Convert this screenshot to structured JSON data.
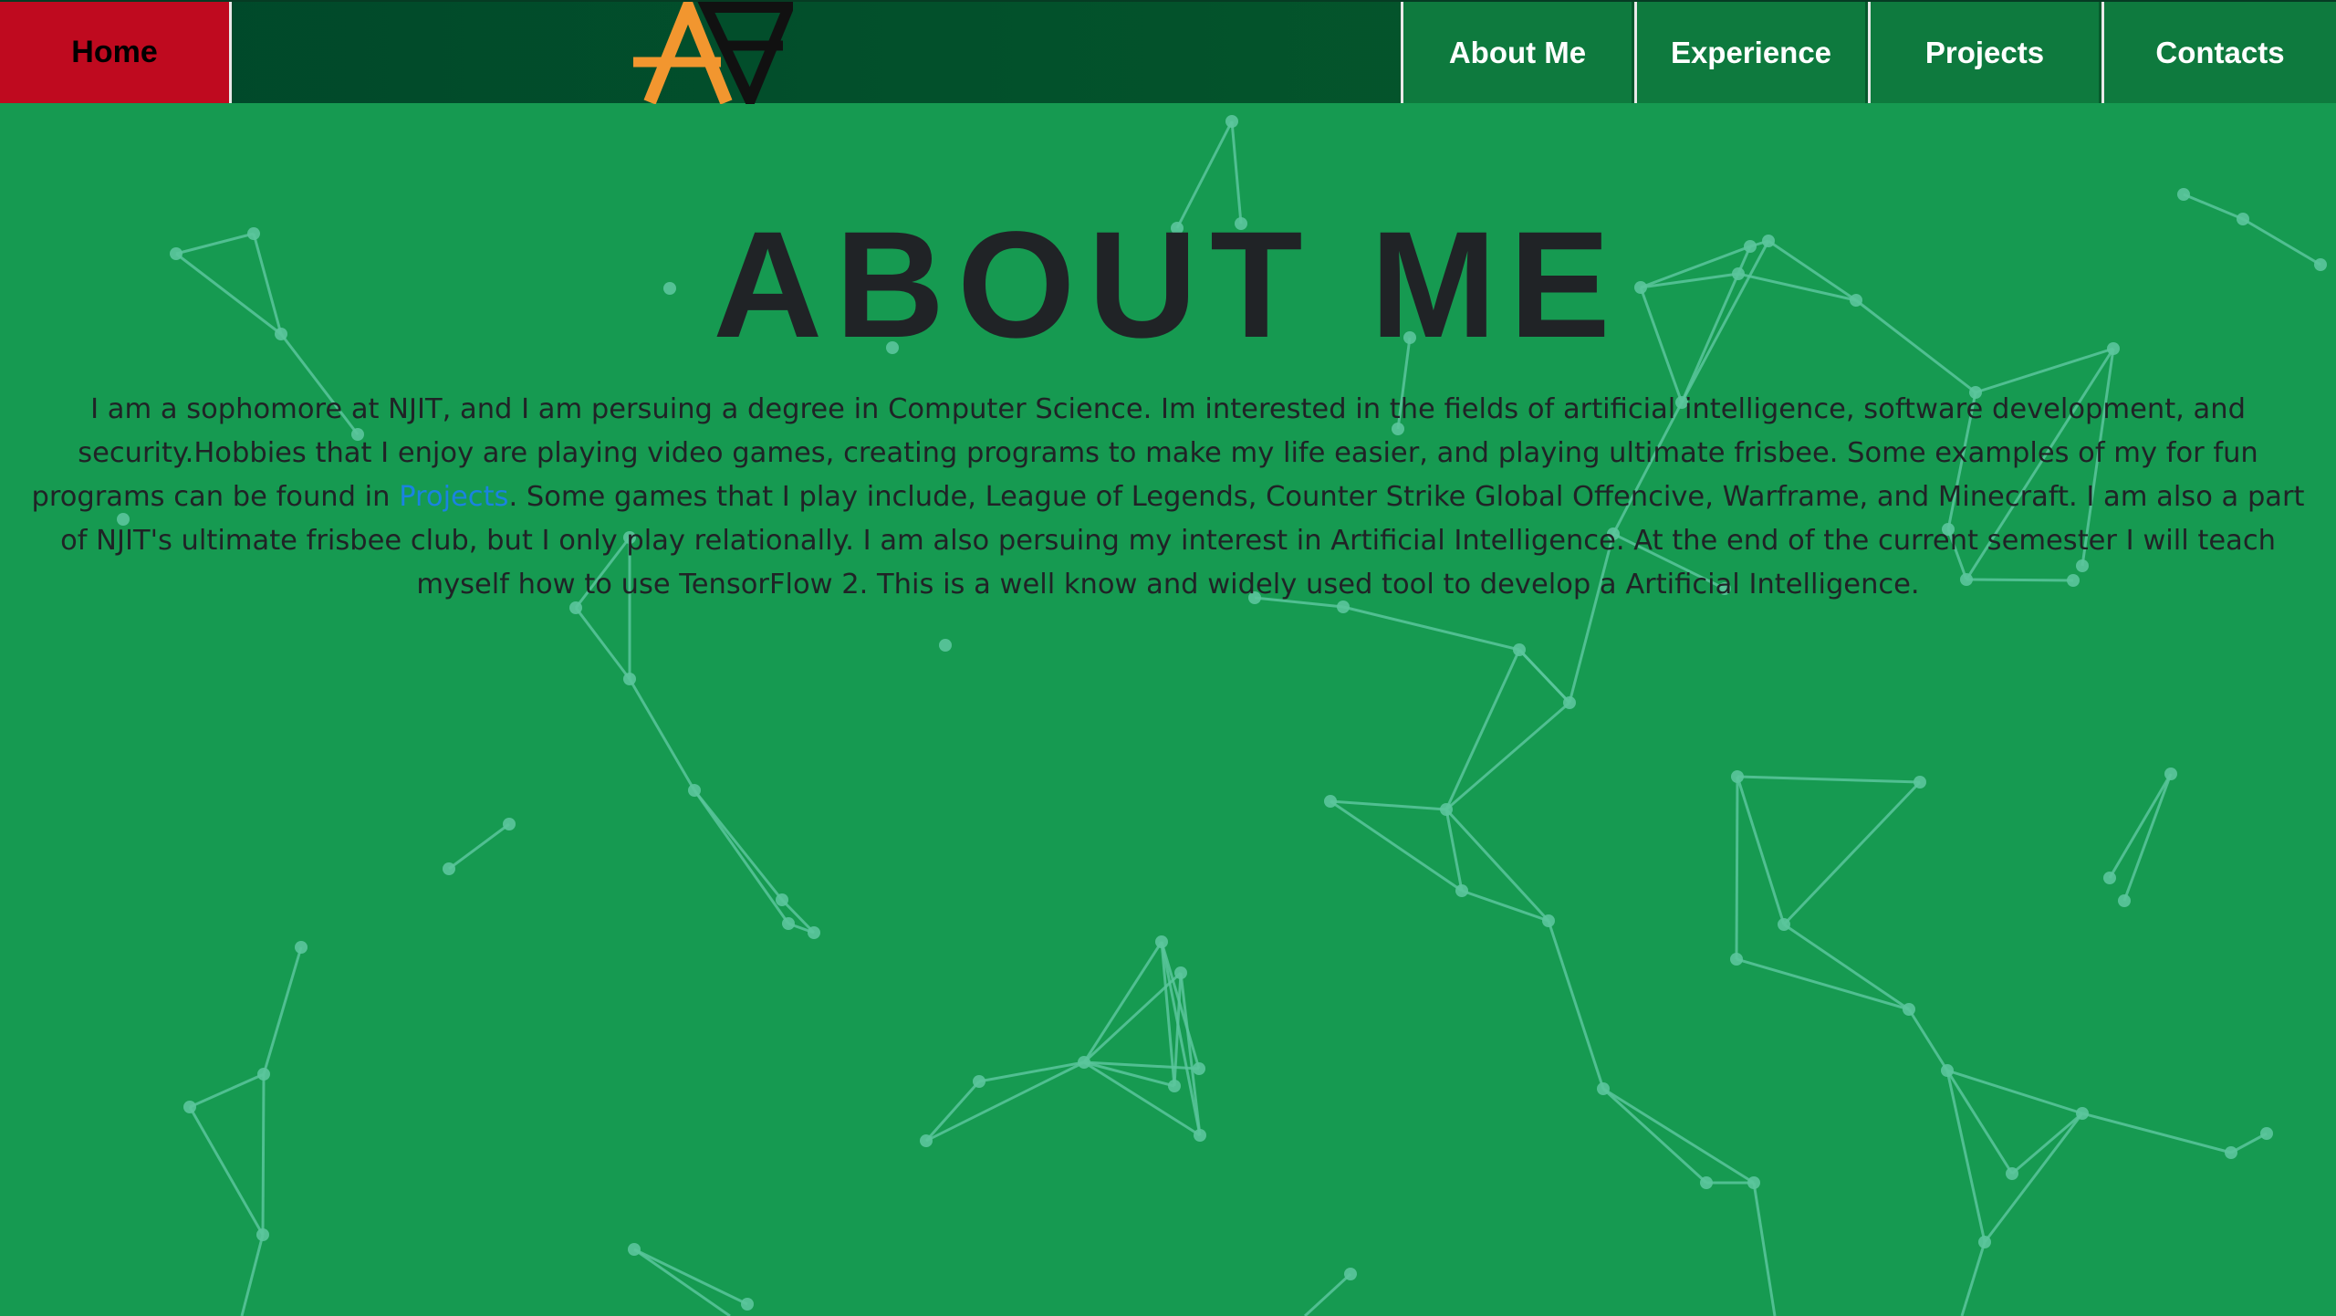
{
  "nav": {
    "home_label": "Home",
    "items": [
      {
        "label": "About Me"
      },
      {
        "label": "Experience"
      },
      {
        "label": "Projects"
      },
      {
        "label": "Contacts"
      }
    ],
    "logo_icon": "aa-monogram-logo",
    "home_color": "#bf0a1f",
    "item_color": "#0e7a3e"
  },
  "main": {
    "title": "ABOUT ME",
    "paragraph_part1": "I am a sophomore at NJIT, and I am persuing a degree in Computer Science. Im interested in the fields of artificial intelligence, software development, and security.Hobbies that I enjoy are playing video games, creating programs to make my life easier, and playing ultimate frisbee. Some examples of my for fun programs can be found in ",
    "projects_link": "Projects",
    "paragraph_part2": ". Some games that I play include, League of Legends, Counter Strike Global Offencive, Warframe, and Minecraft. I am also a part of NJIT's ultimate frisbee club, but I only play relationally. I am also persuing my interest in Artificial Intelligence. At the end of the current semester I will teach myself how to use TensorFlow 2. This is a well know and widely used tool to develop a Artificial Intelligence."
  },
  "theme": {
    "background": "#169a51",
    "particle_color": "#5bc59c",
    "logo_orange": "#f2962f",
    "logo_black": "#111111"
  }
}
